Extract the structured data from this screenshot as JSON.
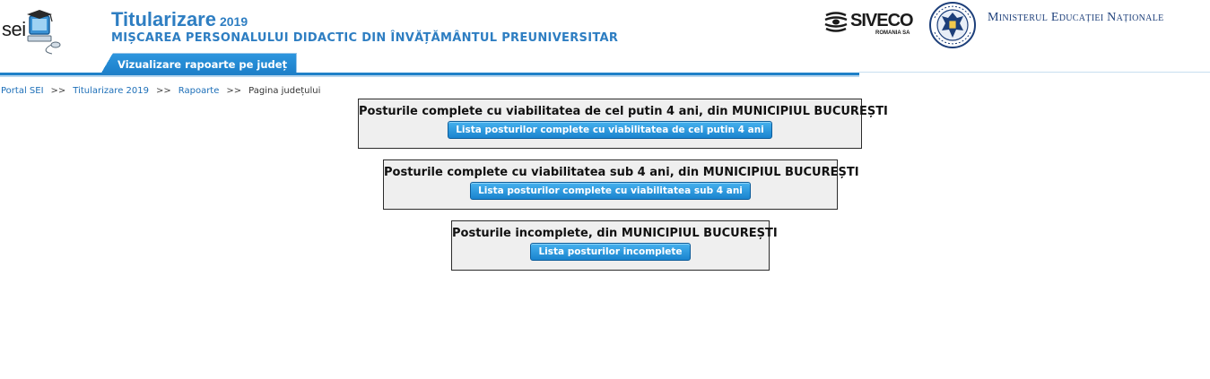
{
  "header": {
    "sei_logo_text": "sei",
    "app_name": "Titularizare",
    "app_year": "2019",
    "subtitle": "MIȘCAREA PERSONALULUI DIDACTIC DIN ÎNVĂȚĂMÂNTUL PREUNIVERSITAR",
    "partner_logo": {
      "word": "SIVECO",
      "sub": "ROMANIA SA"
    },
    "government_seal_icon": "guvernul-romaniei-seal-icon",
    "ministry": "Ministerul Educației Naționale"
  },
  "nav": {
    "tabs": [
      {
        "label": "Vizualizare rapoarte pe județ",
        "active": true
      }
    ]
  },
  "breadcrumb": {
    "items": [
      "Portal SEI",
      "Titularizare 2019",
      "Rapoarte",
      "Pagina județului"
    ],
    "separator": ">>"
  },
  "panels": [
    {
      "title": "Posturile complete cu viabilitatea de cel putin 4 ani, din MUNICIPIUL BUCUREȘTI",
      "button": "Lista posturilor complete cu viabilitatea de cel putin 4 ani"
    },
    {
      "title": "Posturile complete cu viabilitatea sub 4 ani, din MUNICIPIUL BUCUREȘTI",
      "button": "Lista posturilor complete cu viabilitatea sub 4 ani"
    },
    {
      "title": "Posturile incomplete, din MUNICIPIUL BUCUREȘTI",
      "button": "Lista posturilor incomplete"
    }
  ],
  "colors": {
    "accent": "#2e7ec2",
    "tab_bg": "#1c7fc9",
    "button_bg": "#1a84cf",
    "panel_bg": "#efefef",
    "ministry_text": "#1d3f7a"
  }
}
